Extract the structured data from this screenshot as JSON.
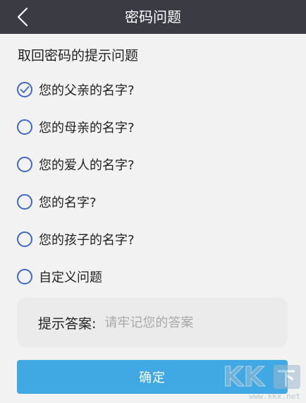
{
  "header": {
    "title": "密码问题",
    "back_icon": "chevron-left-icon"
  },
  "section": {
    "title": "取回密码的提示问题"
  },
  "options": [
    {
      "label": "您的父亲的名字?",
      "selected": true
    },
    {
      "label": "您的母亲的名字?",
      "selected": false
    },
    {
      "label": "您的爱人的名字?",
      "selected": false
    },
    {
      "label": "您的名字?",
      "selected": false
    },
    {
      "label": "您的孩子的名字?",
      "selected": false
    },
    {
      "label": "自定义问题",
      "selected": false
    }
  ],
  "answer": {
    "label": "提示答案:",
    "placeholder": "请牢记您的答案",
    "value": ""
  },
  "confirm": {
    "label": "确定"
  },
  "watermark": {
    "url": "www.kkx.net"
  },
  "colors": {
    "header_bg": "#3b3b44",
    "radio_accent": "#3f68c8",
    "button_bg": "#40a9e3",
    "page_bg": "#f2f2f2"
  }
}
